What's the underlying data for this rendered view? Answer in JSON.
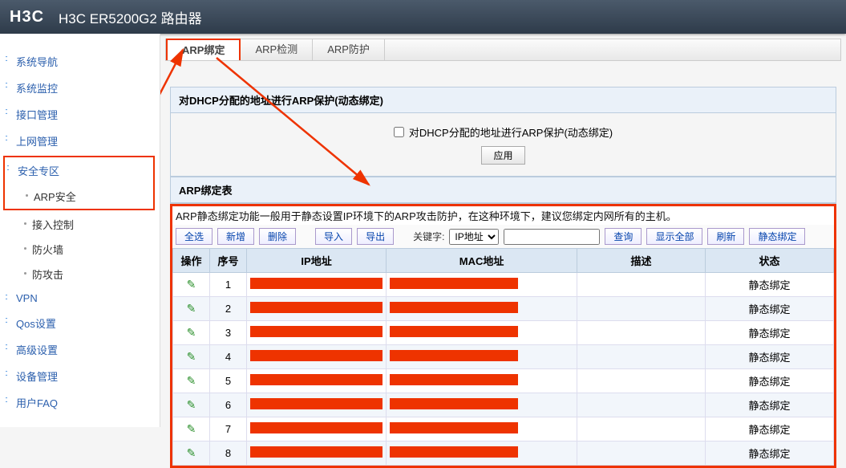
{
  "header": {
    "logo": "H3C",
    "title": "H3C ER5200G2 路由器"
  },
  "sidebar": {
    "top": [
      "系统导航",
      "系统监控",
      "接口管理",
      "上网管理"
    ],
    "security": {
      "label": "安全专区",
      "child": "ARP安全"
    },
    "security_rest": [
      "接入控制",
      "防火墙",
      "防攻击"
    ],
    "bottom": [
      "VPN",
      "Qos设置",
      "高级设置",
      "设备管理",
      "用户FAQ"
    ]
  },
  "tabs": [
    "ARP绑定",
    "ARP检测",
    "ARP防护"
  ],
  "panel1": {
    "title": "对DHCP分配的地址进行ARP保护(动态绑定)",
    "checkbox_label": "对DHCP分配的地址进行ARP保护(动态绑定)",
    "apply": "应用"
  },
  "panel2": {
    "title": "ARP绑定表",
    "desc": "ARP静态绑定功能一般用于静态设置IP环境下的ARP攻击防护，在这种环境下，建议您绑定内网所有的主机。"
  },
  "toolbar": {
    "select_all": "全选",
    "add": "新增",
    "delete": "删除",
    "import": "导入",
    "export": "导出",
    "kw_label": "关键字:",
    "kw_field": "IP地址",
    "search": "查询",
    "show_all": "显示全部",
    "refresh": "刷新",
    "static_bind": "静态绑定"
  },
  "columns": [
    "操作",
    "序号",
    "IP地址",
    "MAC地址",
    "描述",
    "状态"
  ],
  "rows": [
    {
      "idx": "1",
      "status": "静态绑定"
    },
    {
      "idx": "2",
      "status": "静态绑定"
    },
    {
      "idx": "3",
      "status": "静态绑定"
    },
    {
      "idx": "4",
      "status": "静态绑定"
    },
    {
      "idx": "5",
      "status": "静态绑定"
    },
    {
      "idx": "6",
      "status": "静态绑定"
    },
    {
      "idx": "7",
      "status": "静态绑定"
    },
    {
      "idx": "8",
      "status": "静态绑定"
    }
  ]
}
